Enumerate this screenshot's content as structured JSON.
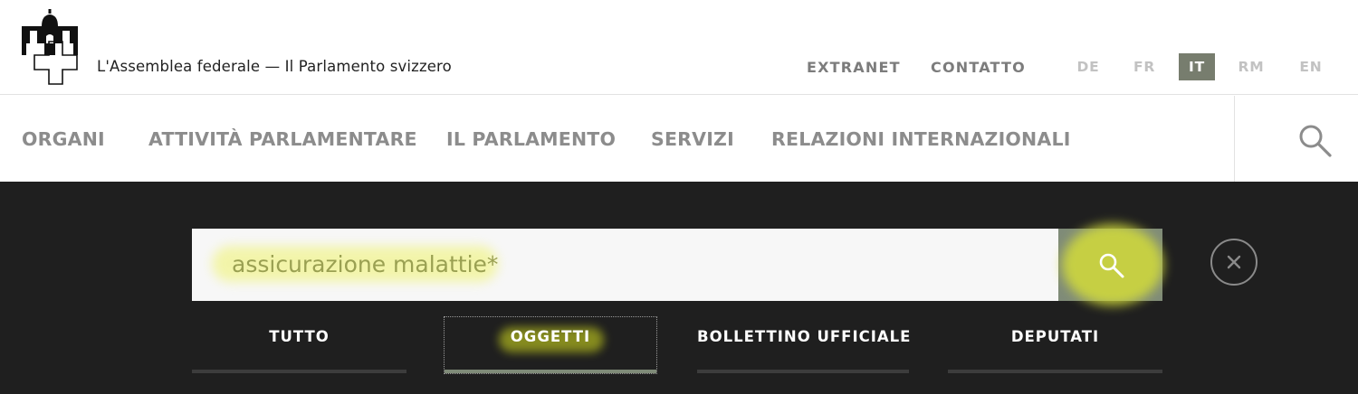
{
  "header": {
    "site_title": "L'Assemblea federale — Il Parlamento svizzero",
    "meta_links": [
      "EXTRANET",
      "CONTATTO"
    ],
    "languages": [
      {
        "code": "DE",
        "active": false
      },
      {
        "code": "FR",
        "active": false
      },
      {
        "code": "IT",
        "active": true
      },
      {
        "code": "RM",
        "active": false
      },
      {
        "code": "EN",
        "active": false
      }
    ]
  },
  "nav": {
    "items": [
      "ORGANI",
      "ATTIVITÀ PARLAMENTARE",
      "IL PARLAMENTO",
      "SERVIZI",
      "RELAZIONI INTERNAZIONALI"
    ],
    "search_icon": "search-icon"
  },
  "search": {
    "query": "assicurazione malattie*",
    "button_icon": "search-icon",
    "close_icon": "close-icon",
    "tabs": [
      {
        "label": "TUTTO",
        "active": false
      },
      {
        "label": "OGGETTI",
        "active": true
      },
      {
        "label": "BOLLETTINO UFFICIALE",
        "active": false
      },
      {
        "label": "DEPUTATI",
        "active": false
      }
    ]
  },
  "colors": {
    "panel_bg": "#1f1f1f",
    "accent": "#7f8b78",
    "highlight": "#d9e31e",
    "nav_text": "#8c8c8c"
  }
}
